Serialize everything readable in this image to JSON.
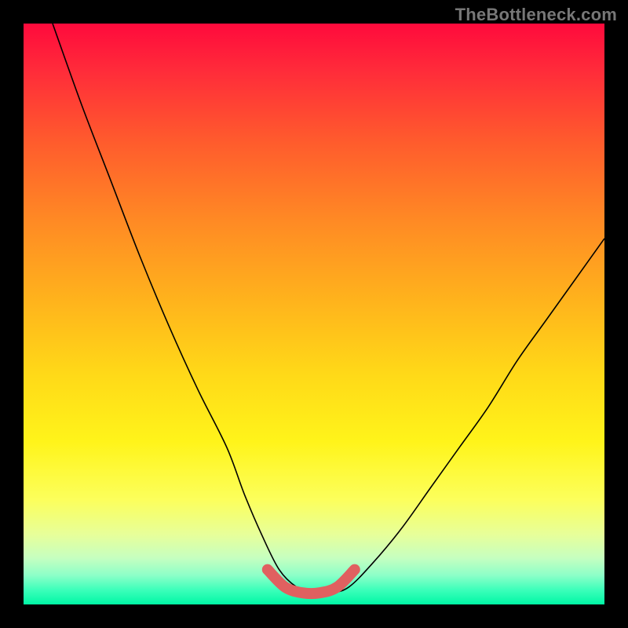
{
  "watermark": "TheBottleneck.com",
  "chart_data": {
    "type": "line",
    "title": "",
    "xlabel": "",
    "ylabel": "",
    "xlim": [
      0,
      100
    ],
    "ylim": [
      0,
      100
    ],
    "grid": false,
    "legend": false,
    "series": [
      {
        "name": "curve",
        "x": [
          5,
          10,
          15,
          20,
          25,
          30,
          35,
          38,
          41,
          44,
          47,
          50,
          53,
          56,
          60,
          65,
          70,
          75,
          80,
          85,
          90,
          95,
          100
        ],
        "y": [
          100,
          86,
          73,
          60,
          48,
          37,
          27,
          19,
          12,
          6,
          3,
          2,
          2,
          3,
          7,
          13,
          20,
          27,
          34,
          42,
          49,
          56,
          63
        ]
      },
      {
        "name": "highlight",
        "x": [
          42,
          45,
          48,
          51,
          54,
          57
        ],
        "y": [
          6,
          3,
          2,
          2,
          3,
          6
        ]
      }
    ],
    "annotations": []
  }
}
